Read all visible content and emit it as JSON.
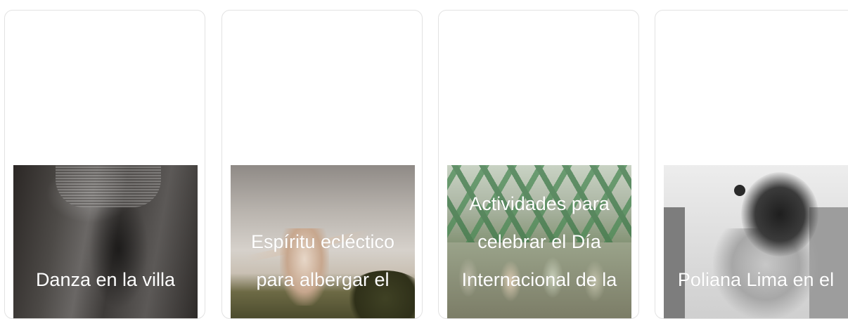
{
  "cards": [
    {
      "caption_lines": [
        "Danza en la villa"
      ],
      "image": "clothing-photo"
    },
    {
      "caption_lines": [
        "Espíritu ecléctico",
        "para albergar el"
      ],
      "image": "dancer-field-photo"
    },
    {
      "caption_lines": [
        "Actividades para",
        "celebrar el Día",
        "Internacional de la"
      ],
      "image": "bridge-crowd-photo"
    },
    {
      "caption_lines": [
        "Poliana Lima en el"
      ],
      "image": "bw-dancer-photo"
    }
  ]
}
